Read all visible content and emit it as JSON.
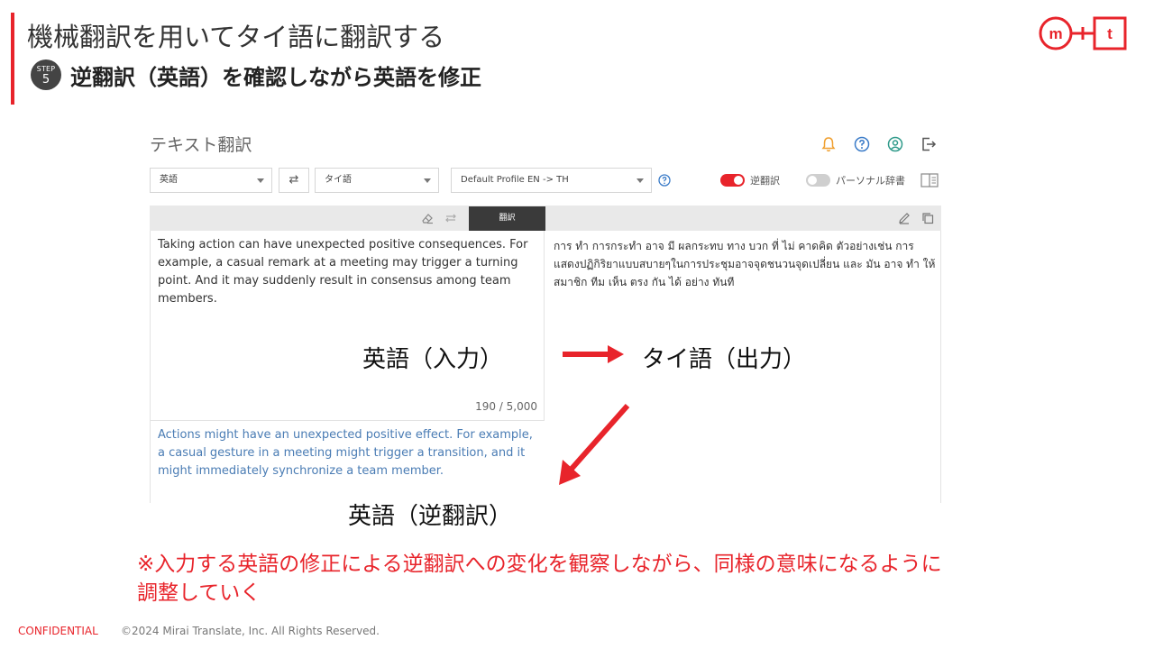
{
  "slide": {
    "title": "機械翻訳を用いてタイ語に翻訳する",
    "step_caption": "STEP",
    "step_number": "5",
    "step_title": "逆翻訳（英語）を確認しながら英語を修正"
  },
  "logo": {
    "left": "m",
    "right": "t",
    "color": "#e8242b"
  },
  "app": {
    "title": "テキスト翻訳",
    "header_icons": [
      "bell-icon",
      "help-circle-icon",
      "user-circle-icon",
      "logout-icon"
    ],
    "source_lang": "英語",
    "target_lang": "タイ語",
    "profile": "Default Profile EN -> TH",
    "back_translation_label": "逆翻訳",
    "back_translation_on": true,
    "personal_dict_label": "パーソナル辞書",
    "personal_dict_on": false,
    "translate_button": "翻訳",
    "source_text": "Taking action can have unexpected positive consequences. For example, a casual remark at a meeting may trigger a turning point. And it may suddenly result in consensus among team members.",
    "char_count": "190 / 5,000",
    "output_text": "การ ทำ การกระทำ อาจ มี ผลกระทบ ทาง บวก ที่ ไม่ คาดคิด ตัวอย่างเช่น การแสดงปฏิกิริยาแบบสบายๆในการประชุมอาจจุดชนวนจุดเปลี่ยน และ มัน อาจ ทำ ให้ สมาชิก ทีม เห็น ตรง กัน ได้ อย่าง ทันที",
    "back_text": "Actions might have an unexpected positive effect. For example, a casual gesture in a meeting might trigger a transition, and it might immediately synchronize a team member."
  },
  "annotations": {
    "input_label": "英語（入力）",
    "output_label": "タイ語（出力）",
    "back_label": "英語（逆翻訳）",
    "note": "※入力する英語の修正による逆翻訳への変化を観察しながら、同様の意味になるように調整していく"
  },
  "footer": {
    "confidential": "CONFIDENTIAL",
    "copyright": "©2024 Mirai Translate, Inc. All Rights Reserved."
  },
  "colors": {
    "accent": "#e8242b",
    "back_text": "#4a7cb4",
    "icon_orange": "#f0a030",
    "icon_blue": "#3a7bc8",
    "icon_teal": "#2f9a8a"
  }
}
